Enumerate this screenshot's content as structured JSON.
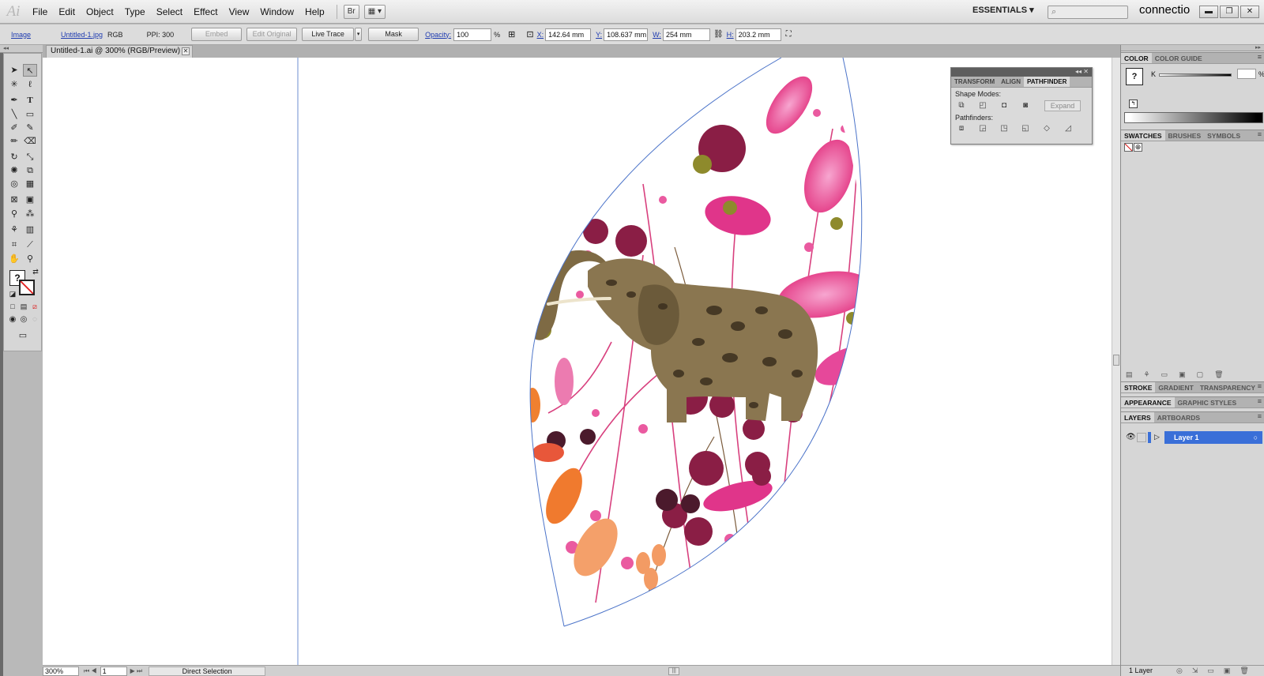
{
  "app": {
    "logo": "Ai",
    "menu": [
      "File",
      "Edit",
      "Object",
      "Type",
      "Select",
      "Effect",
      "View",
      "Window",
      "Help"
    ],
    "bridge_btn": "Br",
    "arrange_btn": "▦ ▾",
    "workspace": "ESSENTIALS ▾",
    "search_placeholder": "⌕",
    "connect_text": "connectio",
    "window_buttons": [
      "▬",
      "❐",
      "✕"
    ]
  },
  "control_bar": {
    "object_type": "Image",
    "file_name": "Untitled-1.jpg",
    "color_mode": "RGB",
    "ppi": "PPI: 300",
    "embed": "Embed",
    "edit_original": "Edit Original",
    "live_trace": "Live Trace",
    "mask": "Mask",
    "opacity_label": "Opacity:",
    "opacity_value": "100",
    "opacity_unit": "%",
    "x_label": "X:",
    "x_value": "142.64 mm",
    "y_label": "Y:",
    "y_value": "108.637 mm",
    "w_label": "W:",
    "w_value": "254 mm",
    "h_label": "H:",
    "h_value": "203.2 mm"
  },
  "document": {
    "tab_title": "Untitled-1.ai @ 300% (RGB/Preview)",
    "close": "✕"
  },
  "status_bar": {
    "zoom": "300%",
    "artboard": "1",
    "tool": "Direct Selection"
  },
  "pathfinder_panel": {
    "tabs": [
      "TRANSFORM",
      "ALIGN",
      "PATHFINDER"
    ],
    "shape_modes_label": "Shape Modes:",
    "pathfinders_label": "Pathfinders:",
    "expand": "Expand"
  },
  "right_dock": {
    "color_tabs": [
      "COLOR",
      "COLOR GUIDE"
    ],
    "k_label": "K",
    "k_unit": "%",
    "swatch_tabs": [
      "SWATCHES",
      "BRUSHES",
      "SYMBOLS"
    ],
    "stroke_tabs": [
      "STROKE",
      "GRADIENT",
      "TRANSPARENCY"
    ],
    "appearance_tabs": [
      "APPEARANCE",
      "GRAPHIC STYLES"
    ],
    "layer_tabs": [
      "LAYERS",
      "ARTBOARDS"
    ],
    "layer_name": "Layer 1",
    "layer_count": "1 Layer"
  }
}
